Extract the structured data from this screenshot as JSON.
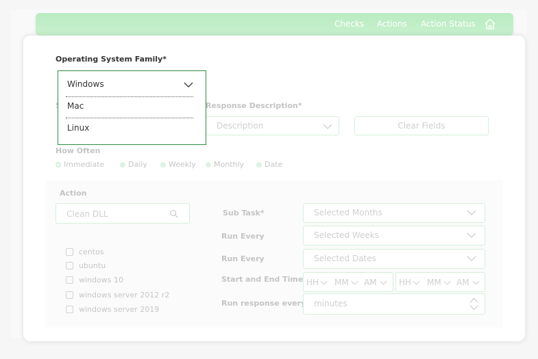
{
  "nav": {
    "checks": "Checks",
    "actions": "Actions",
    "action_status": "Action Status",
    "home_icon": "home-icon"
  },
  "os_family": {
    "label": "Operating System Family*",
    "selected": "Windows",
    "options": [
      "Mac",
      "Linux"
    ]
  },
  "response": {
    "label": "Response Description*",
    "placeholder": "Description",
    "clear_label": "Clear Fields",
    "s_fragment": "S"
  },
  "how_often": {
    "label": "How Often",
    "options": [
      "Immediate",
      "Daily",
      "Weekly",
      "Monthly",
      "Date"
    ]
  },
  "action": {
    "label": "Action",
    "search_placeholder": "Clean DLL",
    "systems": [
      "centos",
      "ubuntu",
      "windows 10",
      "windows server 2012 r2",
      "windows server 2019"
    ]
  },
  "schedule": {
    "sub_task_label": "Sub Task*",
    "sub_task_value": "Selected Months",
    "run_every_label_1": "Run Every",
    "run_every_value_1": "Selected Weeks",
    "run_every_label_2": "Run Every",
    "run_every_value_2": "Selected Dates",
    "start_end_label": "Start and End Time",
    "time_hh": "HH",
    "time_mm": "MM",
    "time_am": "AM",
    "run_response_label": "Run response every*",
    "run_response_placeholder": "minutes"
  },
  "colors": {
    "nav_green": "#bdedc4",
    "dropdown_border": "#2e8b3f"
  }
}
